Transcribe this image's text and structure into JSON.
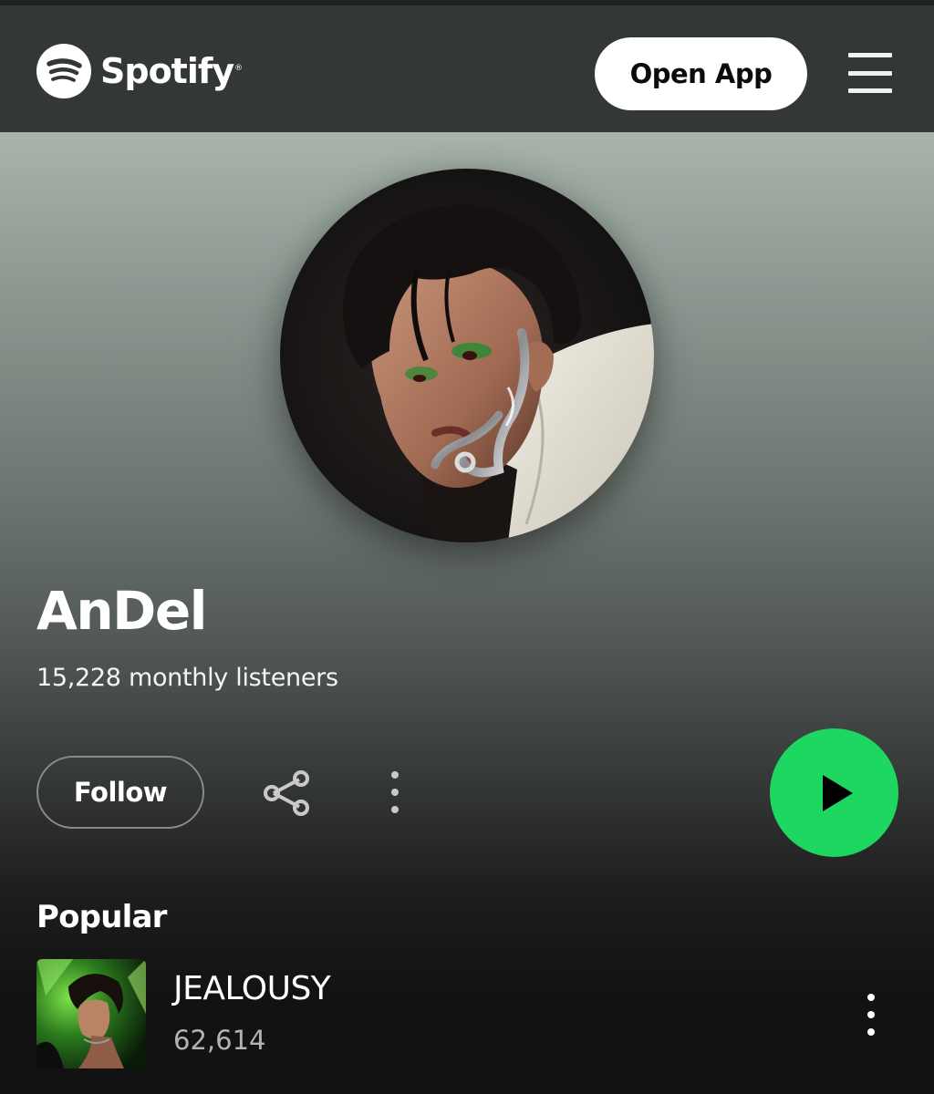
{
  "header": {
    "brand": "Spotify",
    "brand_mark": "®",
    "open_app_label": "Open App",
    "menu_icon": "hamburger-icon"
  },
  "artist": {
    "name": "AnDel",
    "listeners": "15,228 monthly listeners",
    "follow_label": "Follow",
    "share_icon": "share-icon",
    "more_icon": "more-vertical-icon",
    "play_icon": "play-icon"
  },
  "popular": {
    "title": "Popular",
    "tracks": [
      {
        "title": "JEALOUSY",
        "plays": "62,614"
      }
    ]
  },
  "colors": {
    "accent": "#1ed760",
    "topbar": "#333836",
    "background": "#121212",
    "muted_text": "#b3b3b3"
  }
}
